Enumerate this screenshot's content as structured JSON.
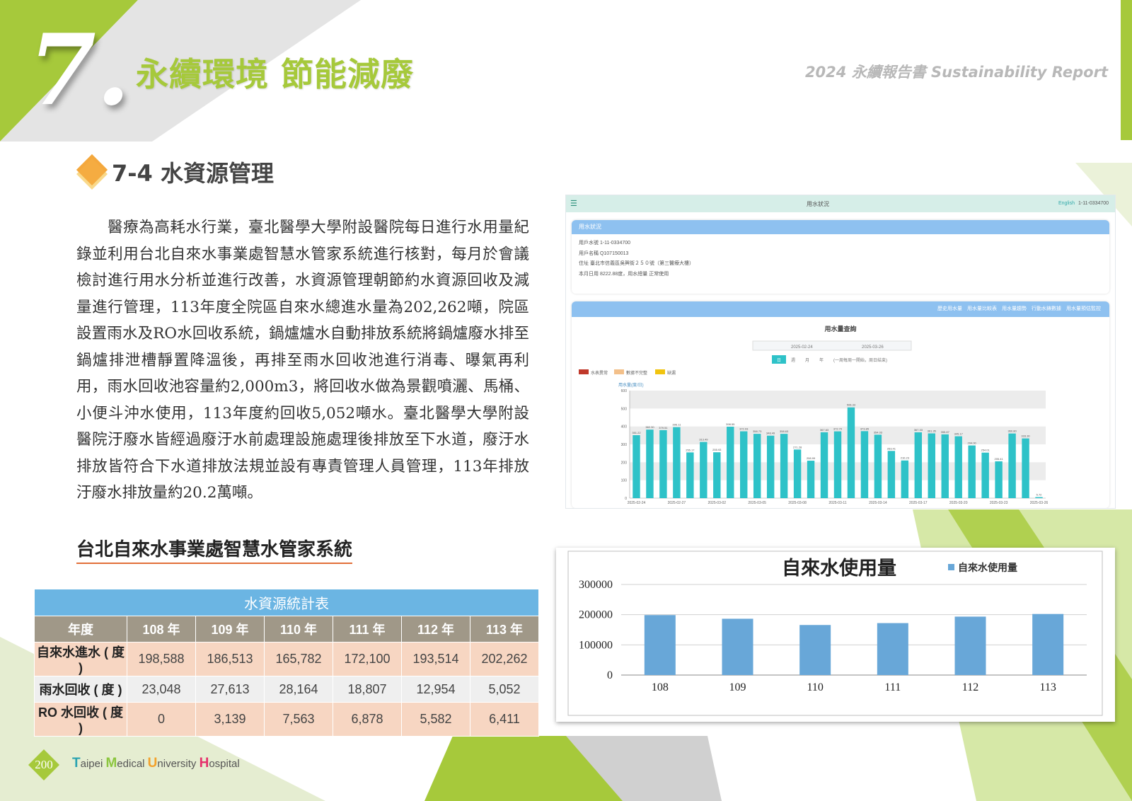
{
  "colors": {
    "accent_green": "#a6c93b",
    "bg_grey": "#d8d8d8",
    "table_blue": "#6bb5e3",
    "bar_blue": "#68a7d8",
    "bar_teal": "#2ec2c8"
  },
  "header": {
    "chapter_number": "7.",
    "chapter_title": "永續環境 節能減廢",
    "report_title": "2024 永續報告書 Sustainability Report"
  },
  "section": {
    "title": "7-4 水資源管理",
    "paragraph": "醫療為高耗水行業，臺北醫學大學附設醫院每日進行水用量紀錄並利用台北自來水事業處智慧水管家系統進行核對，每月於會議檢討進行用水分析並進行改善，水資源管理朝節約水資源回收及減量進行管理，113年度全院區自來水總進水量為202,262噸，院區設置雨水及RO水回收系統，鍋爐爐水自動排放系統將鍋爐廢水排至鍋爐排泄槽靜置降溫後，再排至雨水回收池進行消毒、曝氣再利用，雨水回收池容量約2,000m3，將回收水做為景觀噴灑、馬桶、小便斗沖水使用，113年度約回收5,052噸水。臺北醫學大學附設醫院汙廢水皆經過廢汙水前處理設施處理後排放至下水道，廢汙水排放皆符合下水道排放法規並設有專責管理人員管理，113年排放汙廢水排放量約20.2萬噸。"
  },
  "subsection": {
    "title": "台北自來水事業處智慧水管家系統"
  },
  "table": {
    "caption": "水資源統計表",
    "headers": [
      "年度",
      "108 年",
      "109 年",
      "110 年",
      "111 年",
      "112 年",
      "113 年"
    ],
    "rows": [
      [
        "自來水進水 ( 度 )",
        "198,588",
        "186,513",
        "165,782",
        "172,100",
        "193,514",
        "202,262"
      ],
      [
        "雨水回收 ( 度 )",
        "23,048",
        "27,613",
        "28,164",
        "18,807",
        "12,954",
        "5,052"
      ],
      [
        "RO 水回收 ( 度 )",
        "0",
        "3,139",
        "7,563",
        "6,878",
        "5,582",
        "6,411"
      ]
    ]
  },
  "screenshot": {
    "top_title": "用水狀況",
    "top_right_link": "English",
    "top_right_id": "1-11-0334700",
    "panel1_title": "用水狀況",
    "info_lines": [
      "用戶水號 1-11-0334700",
      "用戶名稱 Q107150013",
      "住址 臺北市信義區吳興街２５０號（第三醫療大樓）",
      "本月日用 8222.88度，用水總量 正常使用"
    ],
    "panel2_tabs": "歷史用水量　用水量比較表　用水量趨勢　行動水錶數據　用水量預估監控",
    "query_title": "用水量查詢",
    "date_from": "2025-02-24",
    "date_to": "2025-03-26",
    "range_buttons": [
      "日",
      "週",
      "月",
      "年"
    ],
    "range_note": "(一周每周一開始，周日結束)",
    "legend": [
      "水表異常",
      "數據不完整",
      "缺漏"
    ],
    "y_unit": "用水量(度/日)",
    "chart_data": {
      "type": "bar",
      "x_ticks": [
        "2025-02-24",
        "2025-02-27",
        "2025-03-02",
        "2025-03-05",
        "2025-03-08",
        "2025-03-11",
        "2025-03-14",
        "2025-03-17",
        "2025-03-20",
        "2025-03-23",
        "2025-03-26"
      ],
      "values": [
        351.22,
        382.3,
        379.51,
        396.11,
        255.17,
        313.49,
        255.93,
        398.55,
        372.93,
        358.73,
        348.49,
        358.63,
        271.28,
        208.99,
        367.63,
        372.7,
        506.33,
        373.85,
        354.03,
        263.41,
        210.23,
        367.33,
        361.35,
        355.87,
        345.17,
        294.0,
        254.01,
        205.41,
        360.8,
        333.3,
        5.72
      ],
      "ylim": [
        0,
        600
      ],
      "y_ticks": [
        "600",
        "500",
        "400",
        "300",
        "200",
        "100",
        "0"
      ]
    }
  },
  "usage_chart": {
    "chart_data": {
      "type": "bar",
      "title": "自來水使用量",
      "legend": "自來水使用量",
      "categories": [
        "108",
        "109",
        "110",
        "111",
        "112",
        "113"
      ],
      "values": [
        198588,
        186513,
        165782,
        172100,
        193514,
        202262
      ],
      "ylim": [
        0,
        300000
      ],
      "y_ticks": [
        "300000",
        "200000",
        "100000",
        "0"
      ],
      "grid": true,
      "legend_position": "top-right"
    }
  },
  "footer": {
    "page_number": "200",
    "brand": [
      {
        "initial": "T",
        "rest": "aipei ",
        "color": "#2aa3b0"
      },
      {
        "initial": "M",
        "rest": "edical ",
        "color": "#8cc63f"
      },
      {
        "initial": "U",
        "rest": "niversity ",
        "color": "#f3a12b"
      },
      {
        "initial": "H",
        "rest": "ospital",
        "color": "#e5306b"
      }
    ]
  }
}
